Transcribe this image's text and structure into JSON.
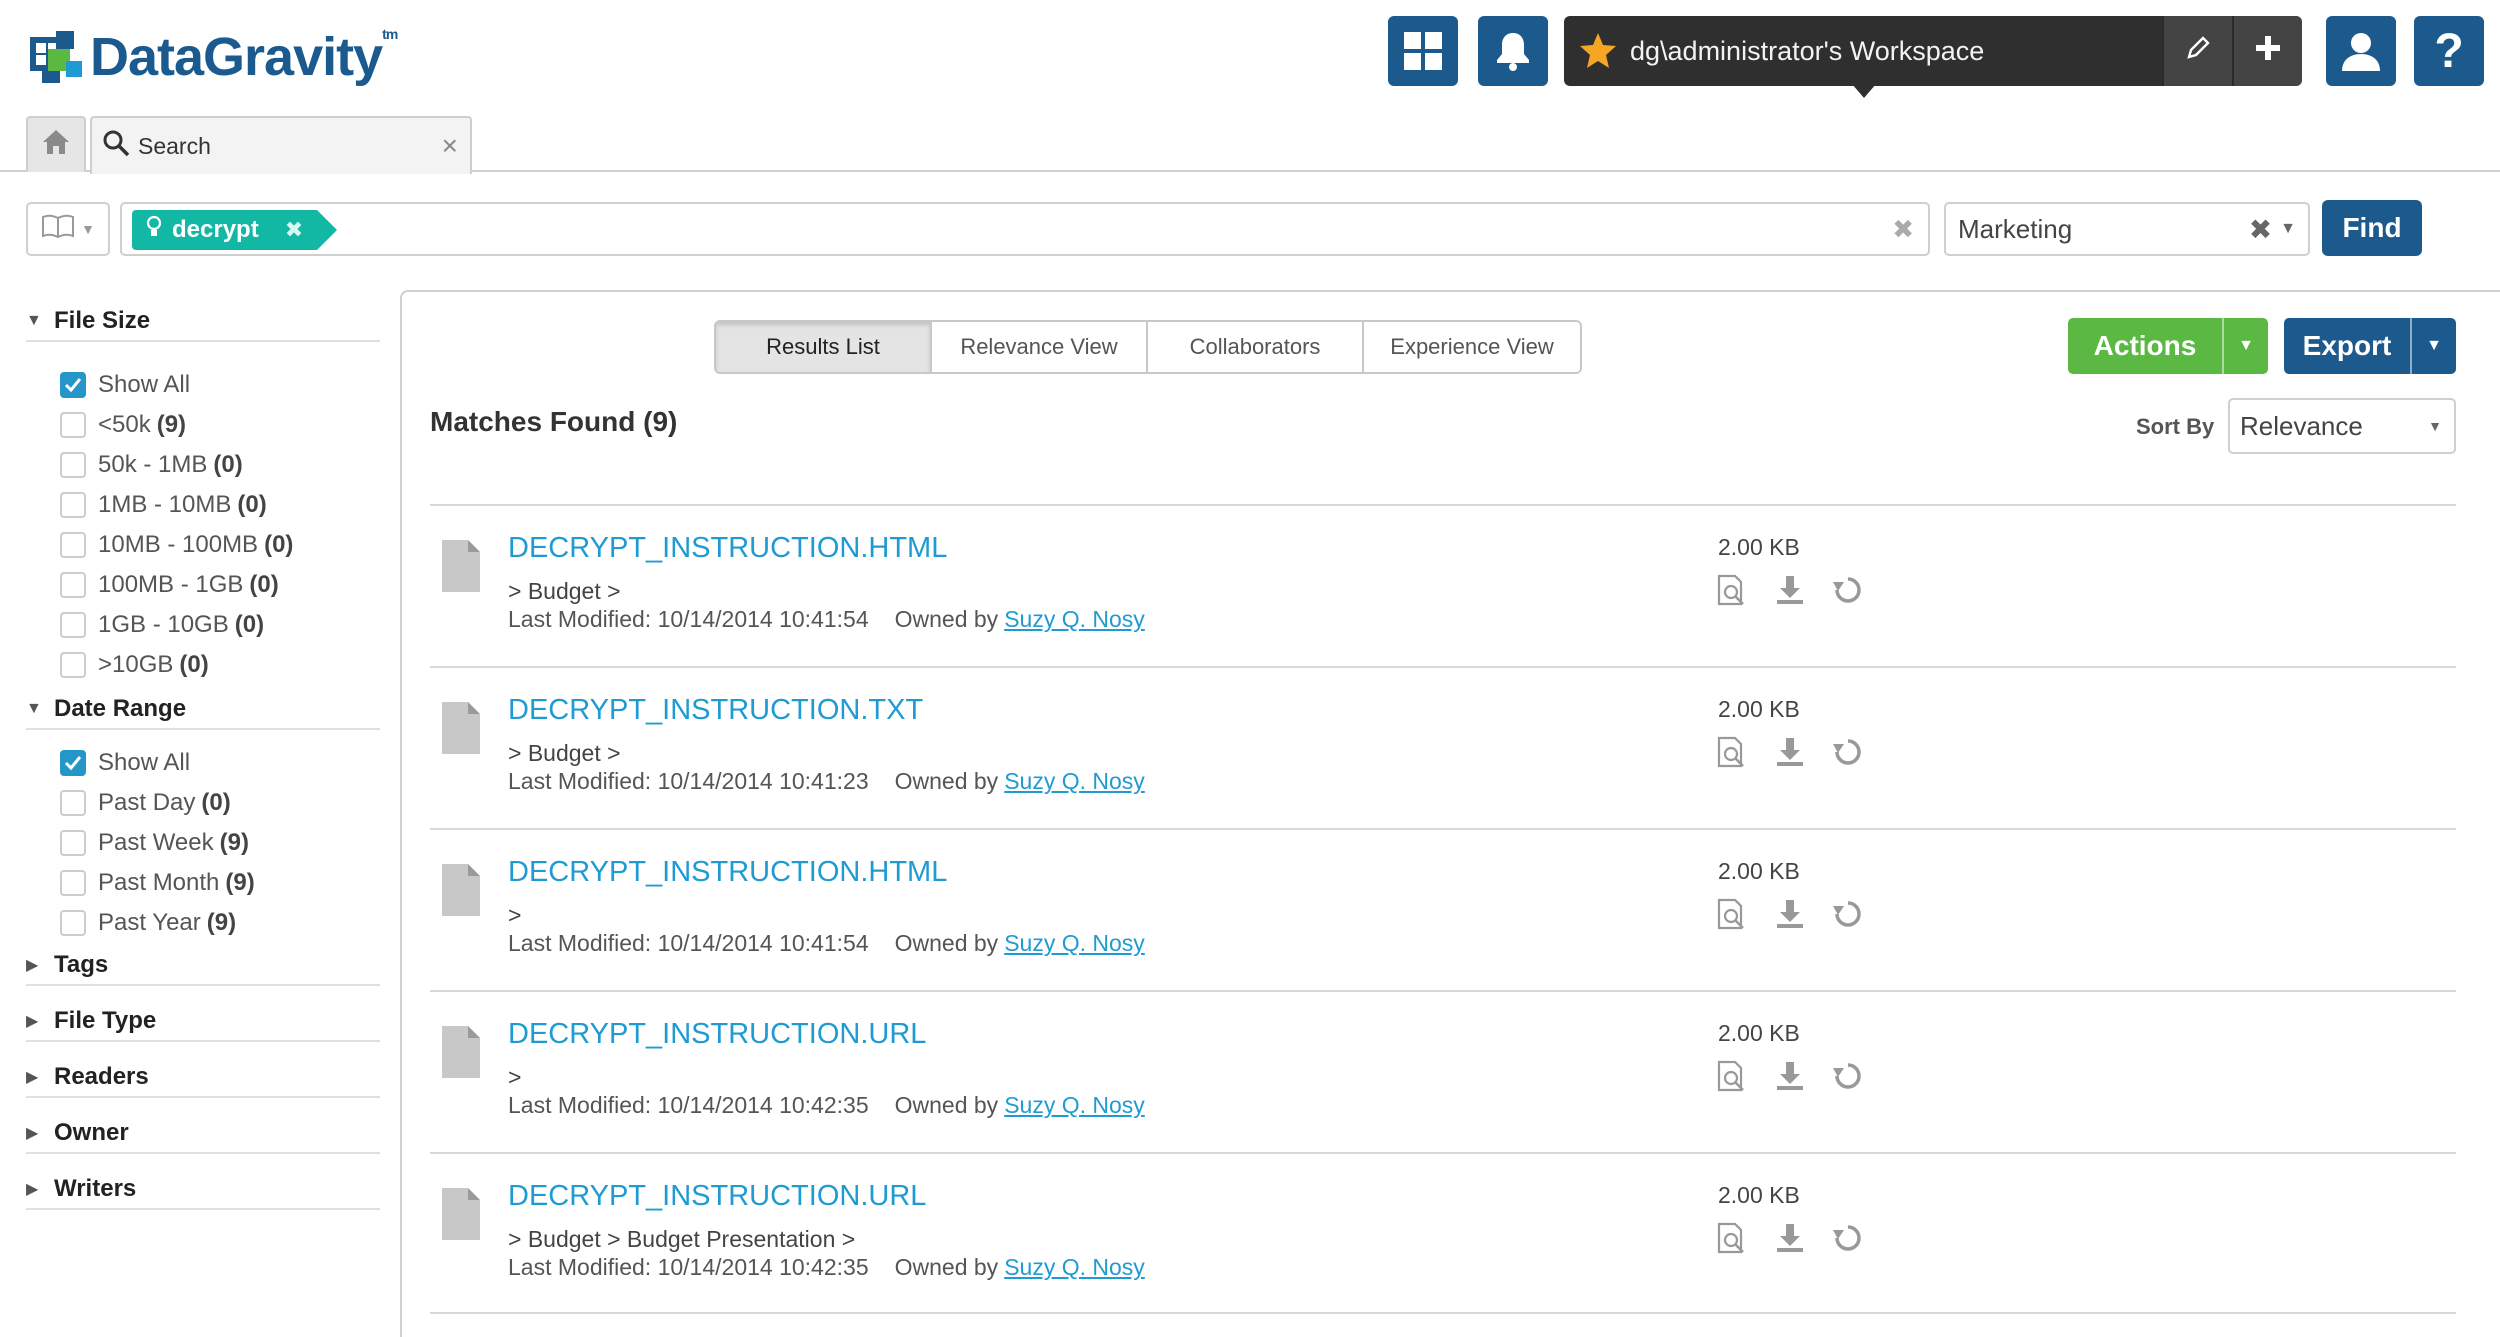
{
  "app": {
    "logo_text": "DataGravity",
    "logo_mark": "tm"
  },
  "header": {
    "workspace_label": "dg\\administrator's Workspace",
    "icons": [
      "dashboard-grid-icon",
      "bell-icon",
      "star-icon",
      "pencil-icon",
      "plus-icon",
      "user-icon",
      "help-icon"
    ]
  },
  "tabs": {
    "home_icon": "home-icon",
    "search_label": "Search",
    "close_glyph": "×"
  },
  "search": {
    "token": "decrypt",
    "token_close": "✖",
    "clear_glyph": "✖",
    "scope_value": "Marketing",
    "scope_clear": "✖",
    "scope_arrow": "▼",
    "find_label": "Find"
  },
  "sidebar": {
    "file_size": {
      "title": "File Size",
      "items": [
        {
          "label": "Show All",
          "count": "",
          "checked": true
        },
        {
          "label": "<50k",
          "count": "(9)",
          "checked": false
        },
        {
          "label": "50k - 1MB",
          "count": "(0)",
          "checked": false
        },
        {
          "label": "1MB - 10MB",
          "count": "(0)",
          "checked": false
        },
        {
          "label": "10MB - 100MB",
          "count": "(0)",
          "checked": false
        },
        {
          "label": "100MB - 1GB",
          "count": "(0)",
          "checked": false
        },
        {
          "label": "1GB - 10GB",
          "count": "(0)",
          "checked": false
        },
        {
          "label": ">10GB",
          "count": "(0)",
          "checked": false
        }
      ]
    },
    "date_range": {
      "title": "Date Range",
      "items": [
        {
          "label": "Show All",
          "count": "",
          "checked": true
        },
        {
          "label": "Past Day",
          "count": "(0)",
          "checked": false
        },
        {
          "label": "Past Week",
          "count": "(9)",
          "checked": false
        },
        {
          "label": "Past Month",
          "count": "(9)",
          "checked": false
        },
        {
          "label": "Past Year",
          "count": "(9)",
          "checked": false
        }
      ]
    },
    "collapsed": [
      "Tags",
      "File Type",
      "Readers",
      "Owner",
      "Writers"
    ]
  },
  "main": {
    "view_tabs": [
      "Results List",
      "Relevance View",
      "Collaborators",
      "Experience View"
    ],
    "active_view": 0,
    "actions_label": "Actions",
    "export_label": "Export",
    "dropdown_arrow": "▼",
    "matches_label": "Matches Found (9)",
    "sort_by_label": "Sort By",
    "sort_by_value": "Relevance",
    "sort_arrow": "▼"
  },
  "results": [
    {
      "name": "DECRYPT_INSTRUCTION.HTML",
      "path": "> Budget >",
      "modified": "Last Modified: 10/14/2014 10:41:54",
      "owned_by": "Owned by",
      "owner": "Suzy Q. Nosy",
      "size": "2.00 KB"
    },
    {
      "name": "DECRYPT_INSTRUCTION.TXT",
      "path": "> Budget >",
      "modified": "Last Modified: 10/14/2014 10:41:23",
      "owned_by": "Owned by",
      "owner": "Suzy Q. Nosy",
      "size": "2.00 KB"
    },
    {
      "name": "DECRYPT_INSTRUCTION.HTML",
      "path": ">",
      "modified": "Last Modified: 10/14/2014 10:41:54",
      "owned_by": "Owned by",
      "owner": "Suzy Q. Nosy",
      "size": "2.00 KB"
    },
    {
      "name": "DECRYPT_INSTRUCTION.URL",
      "path": ">",
      "modified": "Last Modified: 10/14/2014 10:42:35",
      "owned_by": "Owned by",
      "owner": "Suzy Q. Nosy",
      "size": "2.00 KB"
    },
    {
      "name": "DECRYPT_INSTRUCTION.URL",
      "path": "> Budget > Budget Presentation >",
      "modified": "Last Modified: 10/14/2014 10:42:35",
      "owned_by": "Owned by",
      "owner": "Suzy Q. Nosy",
      "size": "2.00 KB"
    }
  ],
  "colors": {
    "brand_blue": "#1c5a8e",
    "link_blue": "#1f9bd3",
    "token_teal": "#13b8a5",
    "actions_green": "#5ab843",
    "checkbox_blue": "#2496c8",
    "star_orange": "#f5a623"
  }
}
